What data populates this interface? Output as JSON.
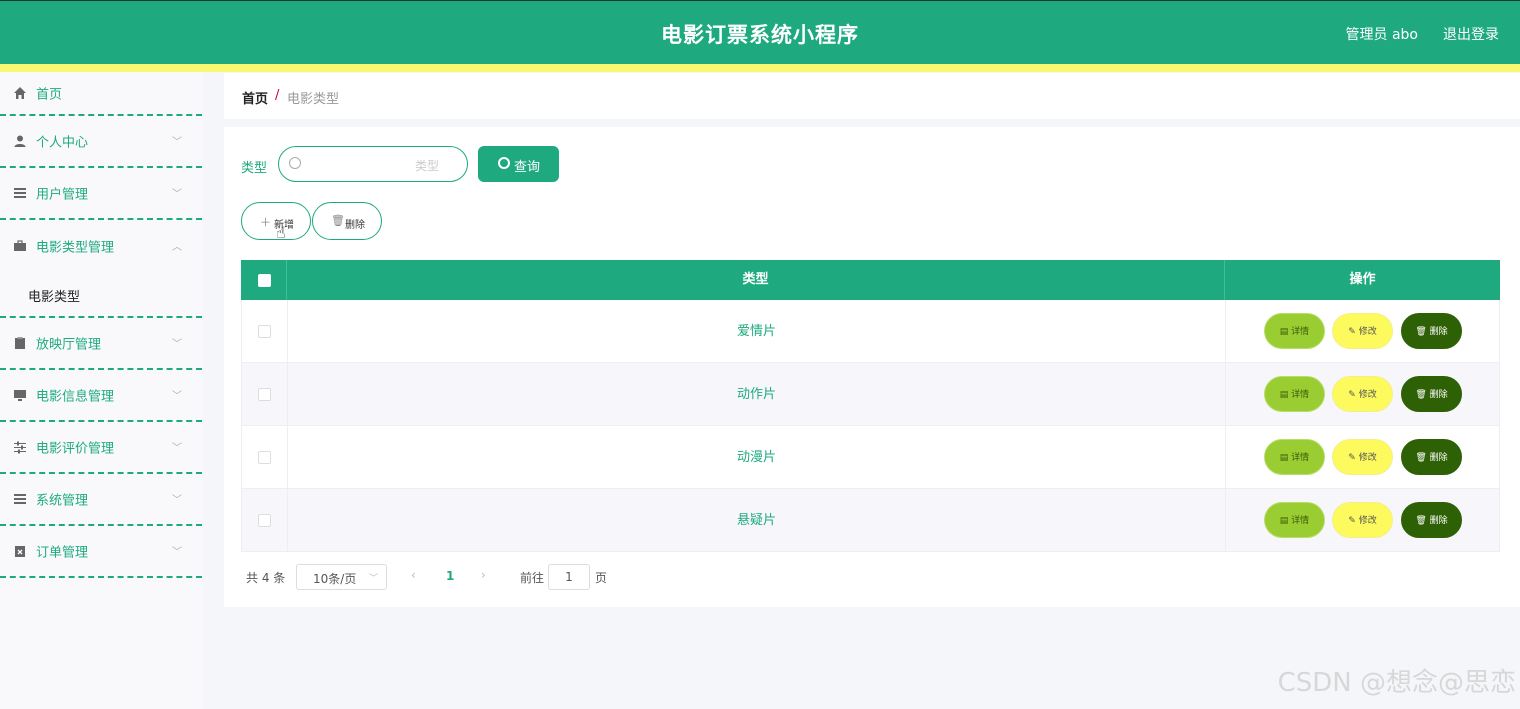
{
  "header": {
    "title": "电影订票系统小程序",
    "user": "管理员 abo",
    "logout": "退出登录"
  },
  "sidebar": {
    "items": [
      {
        "label": "首页",
        "icon": "home-icon"
      },
      {
        "label": "个人中心",
        "icon": "user-icon"
      },
      {
        "label": "用户管理",
        "icon": "list-icon"
      },
      {
        "label": "电影类型管理",
        "icon": "briefcase-icon",
        "expanded": true,
        "sub": "电影类型"
      },
      {
        "label": "放映厅管理",
        "icon": "clipboard-icon"
      },
      {
        "label": "电影信息管理",
        "icon": "monitor-icon"
      },
      {
        "label": "电影评价管理",
        "icon": "sliders-icon"
      },
      {
        "label": "系统管理",
        "icon": "list-icon"
      },
      {
        "label": "订单管理",
        "icon": "clipboard-x-icon"
      }
    ]
  },
  "breadcrumb": {
    "home": "首页",
    "sep": "/",
    "current": "电影类型"
  },
  "search": {
    "label": "类型",
    "placeholder": "类型",
    "button": "查询"
  },
  "actions": {
    "add": "新增",
    "delete": "删除"
  },
  "table": {
    "headers": {
      "type": "类型",
      "ops": "操作"
    },
    "rows": [
      {
        "type": "爱情片"
      },
      {
        "type": "动作片"
      },
      {
        "type": "动漫片"
      },
      {
        "type": "悬疑片"
      }
    ],
    "ops": {
      "detail": "详情",
      "edit": "修改",
      "delete": "删除"
    }
  },
  "pager": {
    "total": "共 4 条",
    "size": "10条/页",
    "page": "1",
    "goto": "前往",
    "goto_value": "1",
    "unit": "页"
  },
  "watermark": "CSDN @想念@思恋",
  "colors": {
    "primary": "#1eaa7e",
    "yellow_bar": "#f9f871",
    "detail": "#9acd32",
    "edit": "#fdfa5d",
    "delete": "#2e6005"
  }
}
